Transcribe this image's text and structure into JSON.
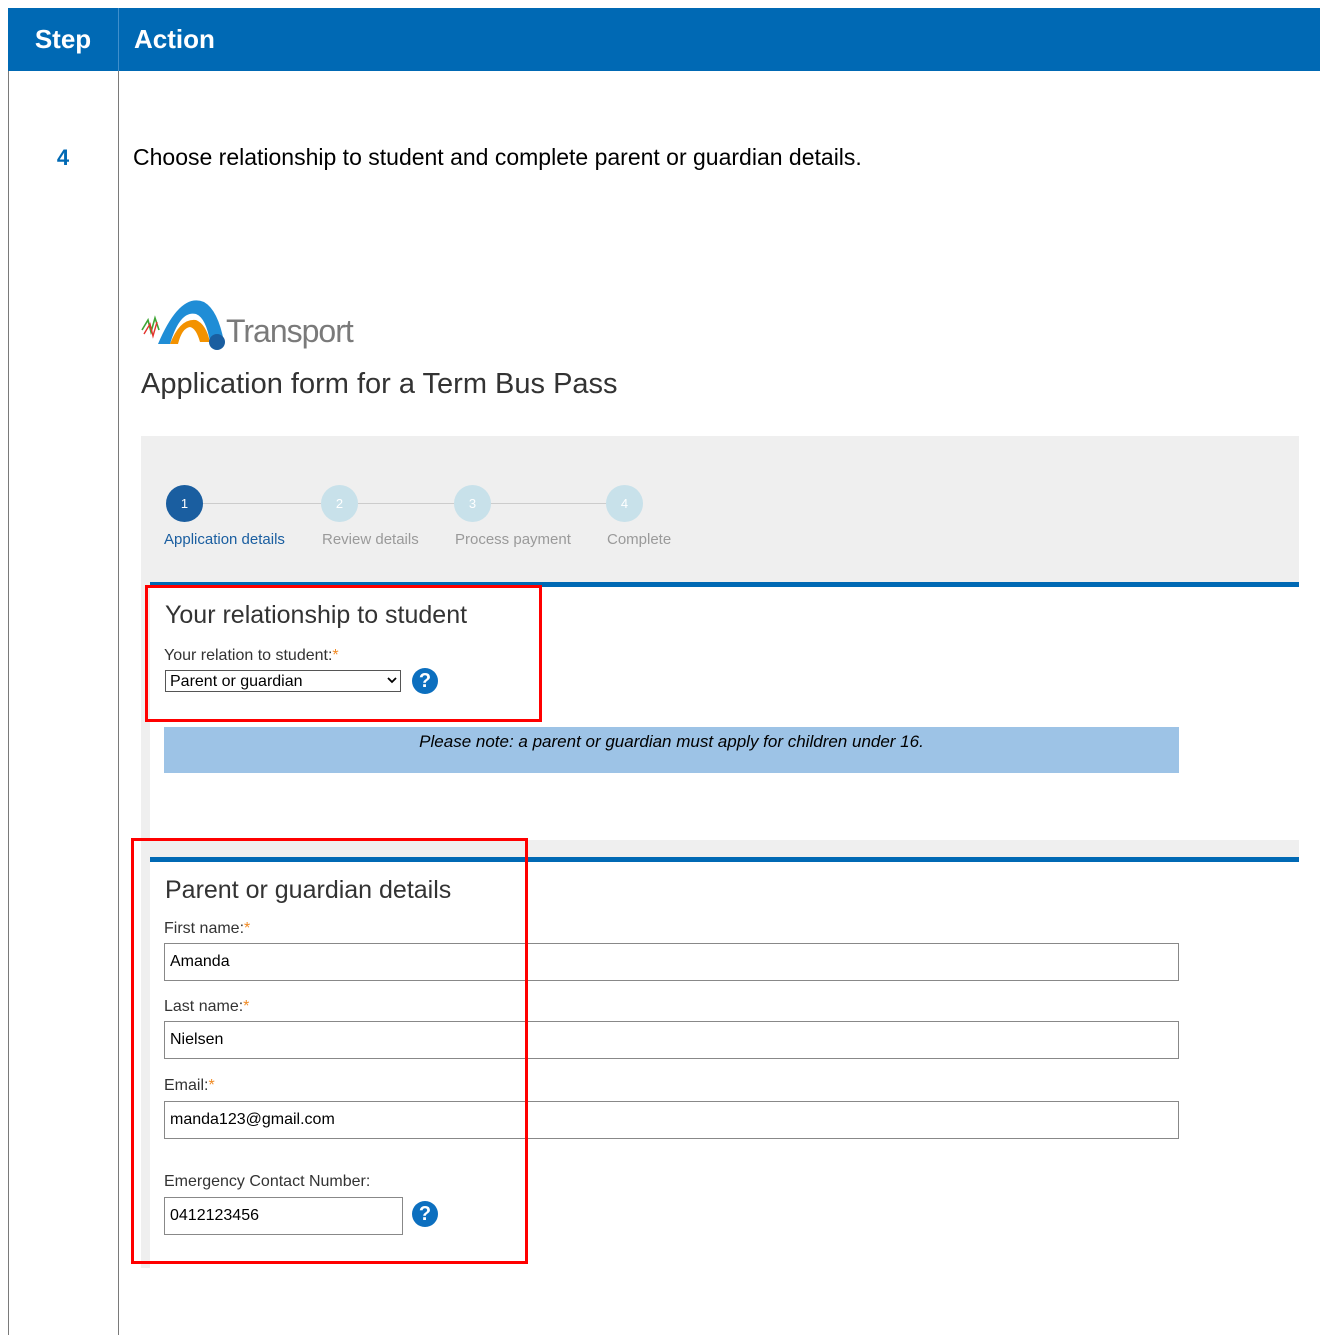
{
  "table": {
    "header_step": "Step",
    "header_action": "Action",
    "step_number": "4",
    "instruction": "Choose relationship to student and complete parent or guardian details."
  },
  "logo": {
    "text": "Transport"
  },
  "form": {
    "title": "Application form for a Term Bus Pass",
    "stepper": [
      {
        "number": "1",
        "label": "Application details",
        "state": "active"
      },
      {
        "number": "2",
        "label": "Review details",
        "state": "inactive"
      },
      {
        "number": "3",
        "label": "Process payment",
        "state": "inactive"
      },
      {
        "number": "4",
        "label": "Complete",
        "state": "inactive"
      }
    ],
    "relationship": {
      "section_title": "Your relationship to student",
      "label": "Your relation to student:",
      "required_mark": "*",
      "selected_value": "Parent or guardian",
      "help_icon": "question-circle-icon",
      "note": "Please note: a parent or guardian must apply for children under 16."
    },
    "guardian": {
      "section_title": "Parent or guardian details",
      "first_name_label": "First name:",
      "first_name_value": "Amanda",
      "last_name_label": "Last name:",
      "last_name_value": "Nielsen",
      "email_label": "Email:",
      "email_value": "manda123@gmail.com",
      "emergency_label": "Emergency Contact Number:",
      "emergency_value": "0412123456",
      "required_mark": "*"
    }
  },
  "colors": {
    "header_blue": "#0069b4",
    "active_step": "#1a5ea0",
    "inactive_step": "#c8e1ea",
    "note_background": "#9dc3e6",
    "required_star": "#f08a24",
    "highlight_red": "#ff0000"
  }
}
